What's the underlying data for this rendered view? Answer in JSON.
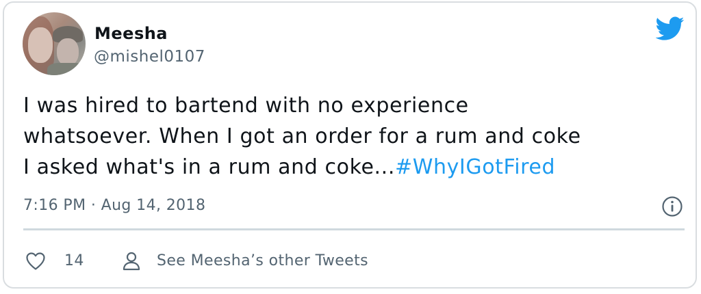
{
  "tweet": {
    "author": {
      "display_name": "Meesha",
      "handle": "@mishel0107"
    },
    "text_lines": [
      "I was hired to bartend with no experience",
      "whatsoever.  When I got an order for a rum and coke",
      "I asked what's in a rum and coke..."
    ],
    "hashtag": "#WhyIGotFired",
    "timestamp": "7:16 PM · Aug 14, 2018",
    "like_count": "14",
    "see_more_label": "See Meesha’s other Tweets"
  },
  "icons": {
    "brand": "twitter-bird-icon",
    "info": "info-icon",
    "like": "heart-icon",
    "profile": "person-icon"
  },
  "colors": {
    "brand_blue": "#1d9bf0",
    "secondary_text": "#536471",
    "divider": "#cfd9de",
    "card_border": "#d9dde0"
  }
}
